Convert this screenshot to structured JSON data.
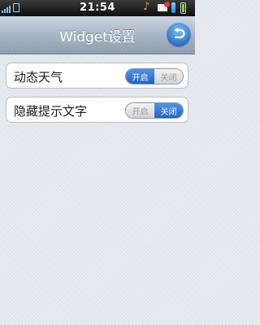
{
  "status_bar": {
    "time": "21:54"
  },
  "title_bar": {
    "title": "Widget设置",
    "back_icon": "back-arrow-icon"
  },
  "settings": [
    {
      "label": "动态天气",
      "on_label": "开启",
      "off_label": "关闭",
      "selected": "on"
    },
    {
      "label": "隐藏提示文字",
      "on_label": "开启",
      "off_label": "关闭",
      "selected": "off"
    }
  ],
  "colors": {
    "accent": "#2e74c4",
    "toggle_active": "#1f63c7"
  }
}
